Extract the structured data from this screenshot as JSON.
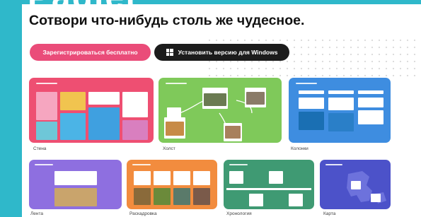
{
  "brand": {
    "logo_text": "Padlet"
  },
  "headline": "Сотвори что-нибудь столь же чудесное.",
  "buttons": {
    "signup_label": "Зарегистрироваться бесплатно",
    "windows_label": "Установить версию для Windows",
    "windows_icon": "windows-logo-icon"
  },
  "colors": {
    "page_border": "#2fb8ca",
    "signup_button": "#ea4c79",
    "windows_button": "#1c1c1c"
  },
  "templates": [
    {
      "label": "Стена",
      "color": "#ee4f72"
    },
    {
      "label": "Холст",
      "color": "#7fc95a"
    },
    {
      "label": "Колонки",
      "color": "#3e8de0"
    },
    {
      "label": "Лента",
      "color": "#8e6fe0"
    },
    {
      "label": "Раскадровка",
      "color": "#f28c3e"
    },
    {
      "label": "Хронология",
      "color": "#3f9a73"
    },
    {
      "label": "Карта",
      "color": "#4c52c9"
    }
  ]
}
